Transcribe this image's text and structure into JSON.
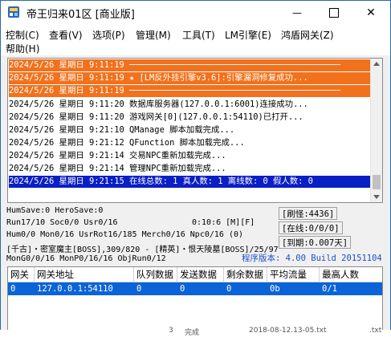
{
  "window": {
    "title": "帝王归来01区 [商业版]",
    "minimize": "—",
    "close": "✕"
  },
  "menu": [
    "控制(C)",
    "查看(V)",
    "选项(P)",
    "管理(M)",
    "工具(T)",
    "LM引擎(E)",
    "鸿盾网关(Z)",
    "帮助(H)"
  ],
  "log": [
    {
      "text": "2024/5/26 星期日 9:11:19 ──────────────────────────────────────────",
      "style": "orange"
    },
    {
      "text": "2024/5/26 星期日 9:11:19 ★ [LM反外挂引擎v3.6]:引擎漏洞修复成功...",
      "style": "orange"
    },
    {
      "text": "2024/5/26 星期日 9:11:19 ──────────────────────────────────────────",
      "style": "orange"
    },
    {
      "text": "2024/5/26 星期日 9:11:20 数据库服务器(127.0.0.1:6001)连接成功...",
      "style": "plain"
    },
    {
      "text": "2024/5/26 星期日 9:11:20 游戏网关[0](127.0.0.1:54110)已打开...",
      "style": "plain"
    },
    {
      "text": "2024/5/26 星期日 9:21:10 QManage 脚本加载完成...",
      "style": "plain"
    },
    {
      "text": "2024/5/26 星期日 9:21:12 QFunction 脚本加载完成...",
      "style": "plain"
    },
    {
      "text": "2024/5/26 星期日 9:21:14 交易NPC重新加载完成...",
      "style": "plain"
    },
    {
      "text": "2024/5/26 星期日 9:21:14 管理NPC重新加载完成...",
      "style": "plain"
    },
    {
      "text": "2024/5/26 星期日 9:21:15 在线总数: 1 真人数: 1 离线数: 0 假人数: 0",
      "style": "blue"
    }
  ],
  "status": {
    "line1": "HumSave:0 HeroSave:0",
    "line2": "Run17/10 Soc0/0 Usr0/16",
    "timer": "0:10:6 [M][F]",
    "line3": "Hum0/0 Mon0/16 UsrRot16/185 Merch0/16 Npc0/16 (0)",
    "line4": "[千古]・密室魔主[BOSS],309/820 - [精英]・恨天陵墓[BOSS]/25/97",
    "line5": "MonG0/0/16 MonP0/16/16 ObjRun0/12",
    "refresh": "[刷怪:4436]",
    "online": "[在线:0/0/0]",
    "expire": "[到期:0.007天]",
    "version": "程序版本: 4.00 Build 20151104"
  },
  "table": {
    "columns": [
      "网关",
      "网关地址",
      "队列数据",
      "发送数据",
      "剩余数据",
      "平均流量",
      "最高人数"
    ],
    "rows": [
      [
        "0",
        "127.0.0.1:54110",
        "0",
        "0",
        "0",
        "0b",
        "0/1"
      ]
    ]
  },
  "background_peek": [
    "3",
    "完成",
    "2018-08-12.13-05.txt",
    ".txt"
  ]
}
